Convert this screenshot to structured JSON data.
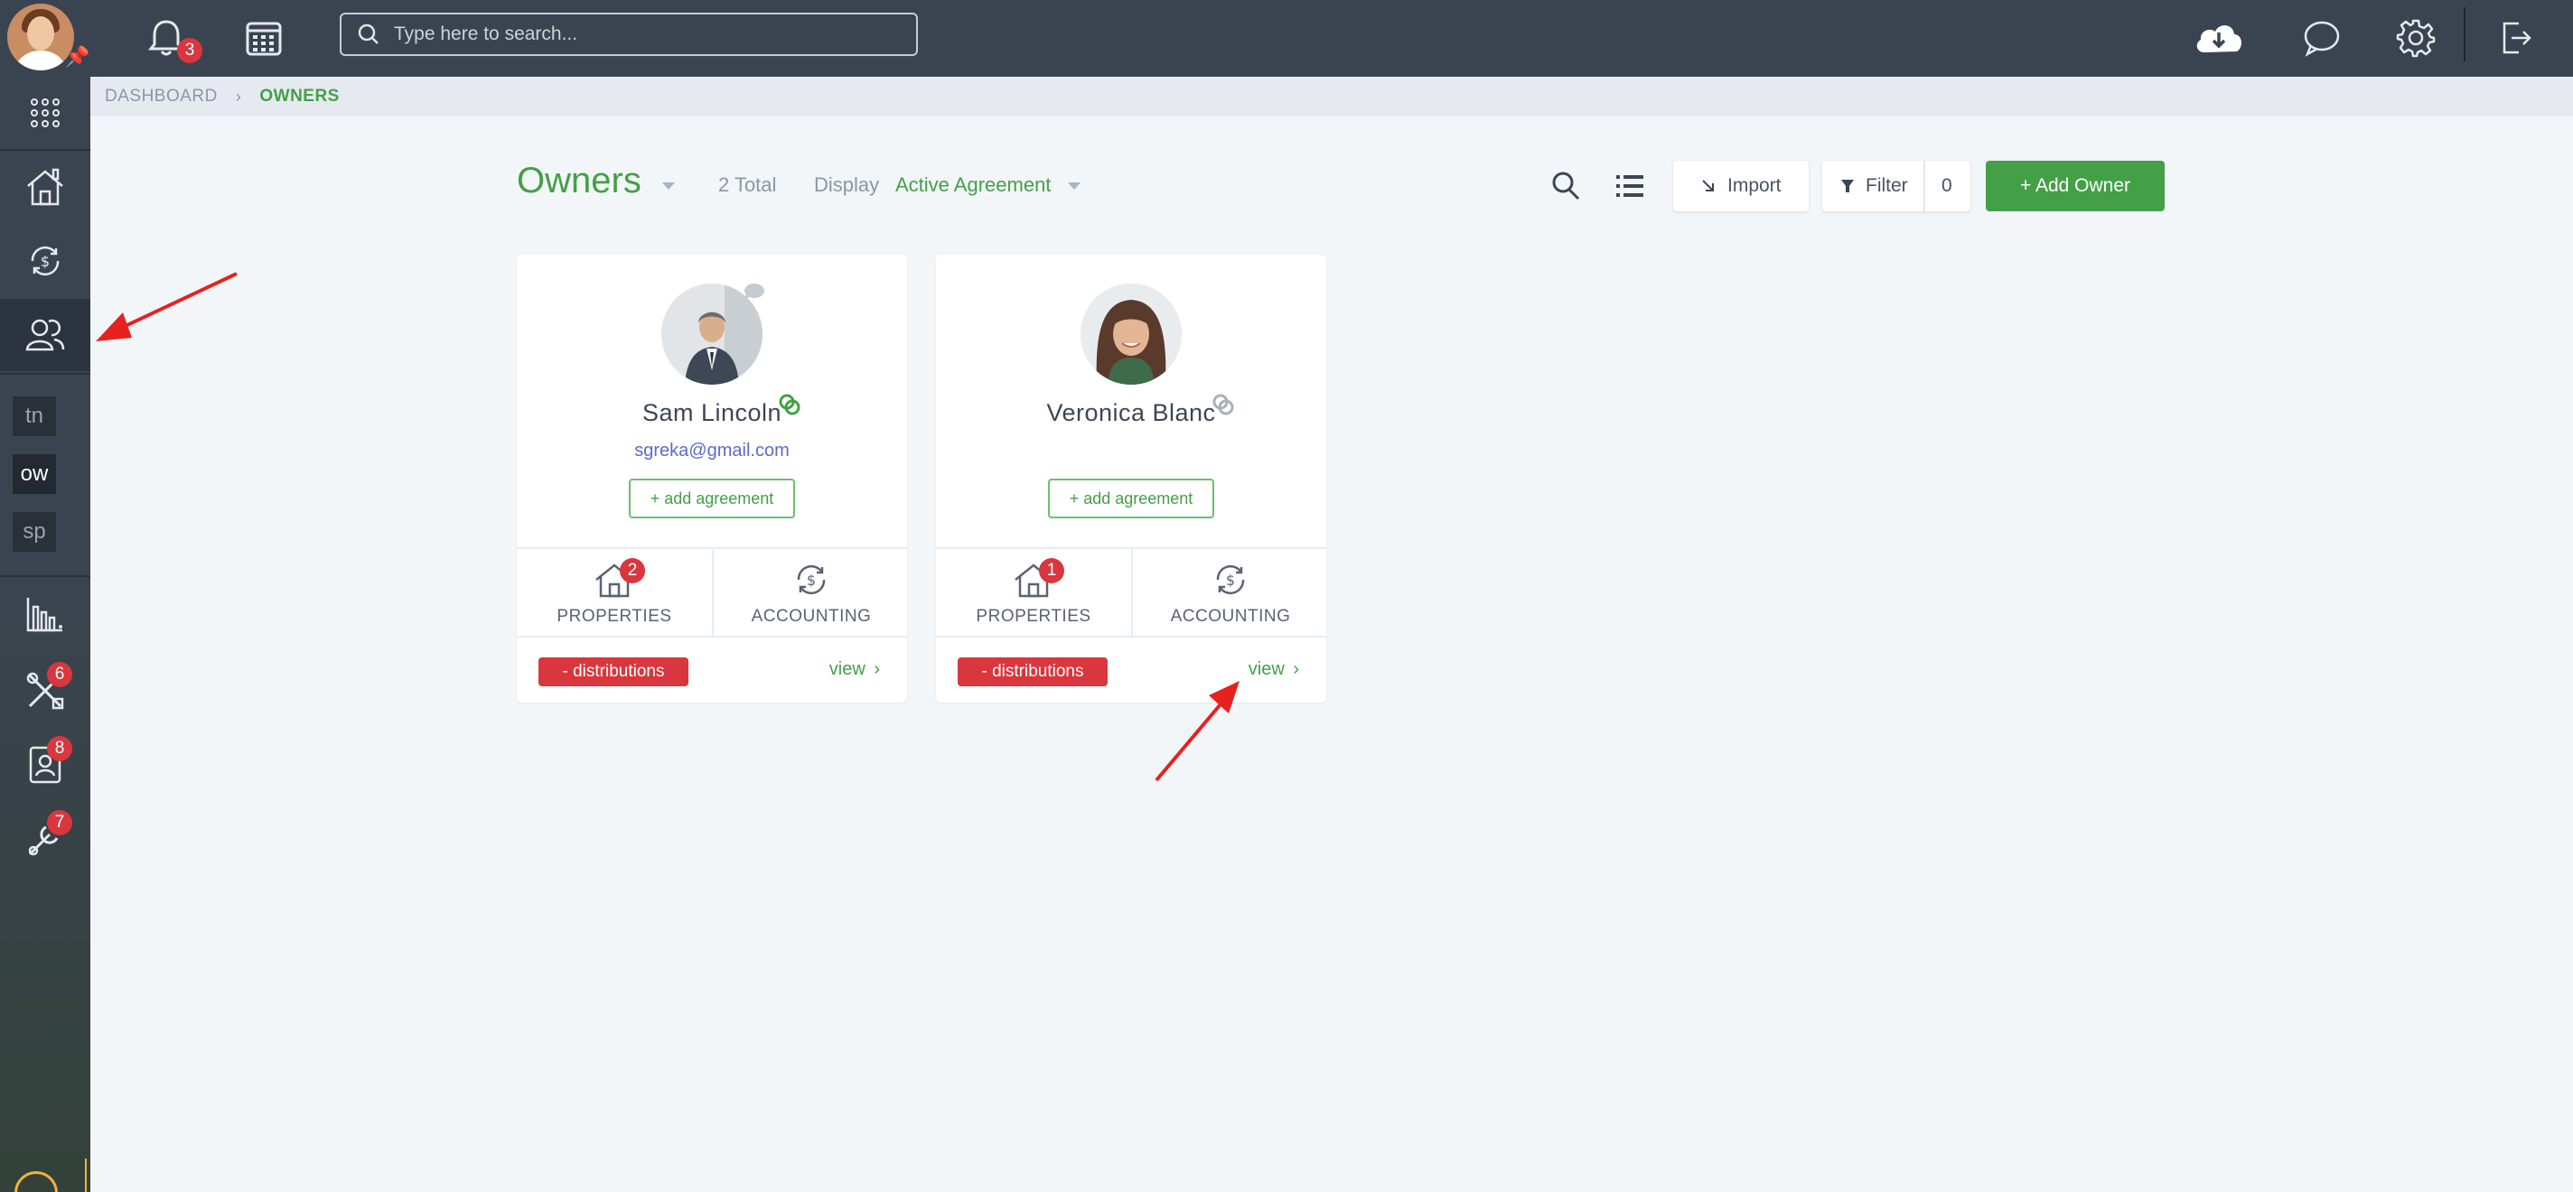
{
  "topbar": {
    "notifications_count": "3",
    "search_placeholder": "Type here to search..."
  },
  "sidebar": {
    "abbr_items": [
      {
        "label": "tn"
      },
      {
        "label": "ow"
      },
      {
        "label": "sp"
      }
    ],
    "badges": {
      "maintenance": "6",
      "contacts": "8",
      "tools": "7"
    }
  },
  "breadcrumb": {
    "items": [
      "DASHBOARD",
      "OWNERS"
    ]
  },
  "header": {
    "title": "Owners",
    "total": "2 Total",
    "display_label": "Display",
    "display_value": "Active Agreement",
    "import_label": "Import",
    "filter_label": "Filter",
    "filter_count": "0",
    "add_owner_label": "+ Add Owner"
  },
  "owners": [
    {
      "name": "Sam Lincoln",
      "email": "sgreka@gmail.com",
      "add_agreement": "+ add agreement",
      "properties_count": "2",
      "properties_label": "PROPERTIES",
      "accounting_label": "ACCOUNTING",
      "distributions": "- distributions",
      "view": "view"
    },
    {
      "name": "Veronica Blanc",
      "add_agreement": "+ add agreement",
      "properties_count": "1",
      "properties_label": "PROPERTIES",
      "accounting_label": "ACCOUNTING",
      "distributions": "- distributions",
      "view": "view"
    }
  ],
  "colors": {
    "topbar": "#3a4451",
    "accent_green": "#43a047",
    "badge_red": "#d9363e",
    "annotation_red": "#e8201e"
  }
}
